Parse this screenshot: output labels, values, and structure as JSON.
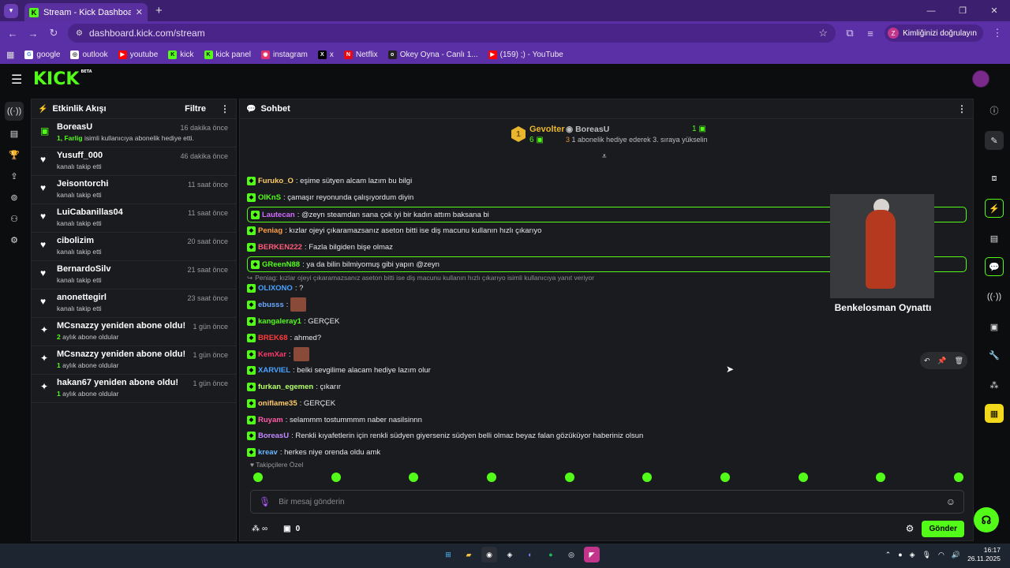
{
  "browser": {
    "tab_title": "Stream - Kick Dashboard",
    "url": "dashboard.kick.com/stream",
    "profile_label": "Kimliğinizi doğrulayın",
    "profile_initial": "Z",
    "bookmarks": [
      {
        "label": "google",
        "icon": "google-icon",
        "color": "#ffffff"
      },
      {
        "label": "outlook",
        "icon": "outlook-icon",
        "color": "#ffffff"
      },
      {
        "label": "youtube",
        "icon": "youtube-icon",
        "color": "#ff0000"
      },
      {
        "label": "kick",
        "icon": "kick-icon",
        "color": "#53fc18"
      },
      {
        "label": "kick panel",
        "icon": "kick-icon",
        "color": "#53fc18"
      },
      {
        "label": "instagram",
        "icon": "instagram-icon",
        "color": "#e1306c"
      },
      {
        "label": "x",
        "icon": "x-icon",
        "color": "#000000"
      },
      {
        "label": "Netflix",
        "icon": "netflix-icon",
        "color": "#e50914"
      },
      {
        "label": "Okey Oyna - Canlı 1...",
        "icon": "okey-icon",
        "color": "#222222"
      },
      {
        "label": "(159) ;) - YouTube",
        "icon": "youtube-icon",
        "color": "#ff0000"
      }
    ]
  },
  "kick": {
    "logo": "KICK",
    "logo_tag": "BETA",
    "accent": "#53fc18"
  },
  "activity": {
    "title": "Etkinlik Akışı",
    "filter_label": "Filtre",
    "items": [
      {
        "name": "BoreasU",
        "time": "16 dakika önce",
        "highlight": "1, Farlig",
        "sub": " isimli kullanıcıya abonelik hediye etti.",
        "icon": "gift-icon"
      },
      {
        "name": "Yusuff_000",
        "time": "46 dakika önce",
        "highlight": "",
        "sub": "kanalı takip etti",
        "icon": "heart-icon"
      },
      {
        "name": "Jeisontorchi",
        "time": "11 saat önce",
        "highlight": "",
        "sub": "kanalı takip etti",
        "icon": "heart-icon"
      },
      {
        "name": "LuiCabanillas04",
        "time": "11 saat önce",
        "highlight": "",
        "sub": "kanalı takip etti",
        "icon": "heart-icon"
      },
      {
        "name": "cibolizim",
        "time": "20 saat önce",
        "highlight": "",
        "sub": "kanalı takip etti",
        "icon": "heart-icon"
      },
      {
        "name": "BernardoSilv",
        "time": "21 saat önce",
        "highlight": "",
        "sub": "kanalı takip etti",
        "icon": "heart-icon"
      },
      {
        "name": "anonettegirl",
        "time": "23 saat önce",
        "highlight": "",
        "sub": "kanalı takip etti",
        "icon": "heart-icon"
      },
      {
        "name": "MCsnazzy yeniden abone oldu!",
        "time": "1 gün önce",
        "highlight": "2",
        "sub": " aylık abone oldular",
        "icon": "sparkle-icon"
      },
      {
        "name": "MCsnazzy yeniden abone oldu!",
        "time": "1 gün önce",
        "highlight": "1",
        "sub": " aylık abone oldular",
        "icon": "sparkle-icon"
      },
      {
        "name": "hakan67 yeniden abone oldu!",
        "time": "1 gün önce",
        "highlight": "1",
        "sub": " aylık abone oldular",
        "icon": "sparkle-icon"
      }
    ]
  },
  "chat": {
    "title": "Sohbet",
    "leaderboard": {
      "rank": "1",
      "top_user": "Gevolter",
      "top_count": "6",
      "second_user": "BoreasU",
      "second_count": "1",
      "second_rank": "3",
      "message": "1 abonelik hediye ederek 3. sıraya yükselin"
    },
    "messages": [
      {
        "user": "Furuko_O",
        "color": "#ffcc66",
        "text": ": eşime sütyen alcam lazım bu bilgi",
        "highlight": false,
        "emote": false
      },
      {
        "user": "OlKnS",
        "color": "#53fc18",
        "text": ": çamaşır reyonunda çalışıyordum diyin",
        "highlight": false,
        "emote": false
      },
      {
        "user": "Lautecan",
        "color": "#d26bff",
        "text": ": @zeyn steamdan sana çok iyi bir kadın attım baksana bi",
        "highlight": true,
        "emote": false
      },
      {
        "user": "Peniag",
        "color": "#ff9f43",
        "text": ": kızlar ojeyi çıkaramazsanız aseton bitti ise diş macunu kullanın hızlı çıkarıyo",
        "highlight": false,
        "emote": false
      },
      {
        "user": "BERKEN222",
        "color": "#ff5c7a",
        "text": ": Fazla bilgiden bişe olmaz",
        "highlight": false,
        "emote": false
      },
      {
        "user": "GReenN88",
        "color": "#53fc18",
        "text": ": ya da bilin bilmiyomuş gibi yapın @zeyn",
        "highlight": true,
        "emote": false
      },
      {
        "user": "OLIXONO",
        "color": "#4aa3ff",
        "text": ": ?",
        "highlight": false,
        "emote": false
      },
      {
        "user": "ebusss",
        "color": "#6aa8ff",
        "text": ":",
        "highlight": false,
        "emote": true
      },
      {
        "user": "kangaleray1",
        "color": "#53fc18",
        "text": ": GERÇEK",
        "highlight": false,
        "emote": false
      },
      {
        "user": "BREK68",
        "color": "#ff3b3b",
        "text": ": ahmed?",
        "highlight": false,
        "emote": false
      },
      {
        "user": "KemXar",
        "color": "#ff3b6b",
        "text": ":",
        "highlight": false,
        "emote": true
      },
      {
        "user": "XARVIEL",
        "color": "#4aa3ff",
        "text": ": belki sevgilime alacam hediye lazım olur",
        "highlight": false,
        "emote": false
      },
      {
        "user": "furkan_egemen",
        "color": "#b6ff6a",
        "text": ": çıkarır",
        "highlight": false,
        "emote": false
      },
      {
        "user": "oniflame35",
        "color": "#ffcc66",
        "text": ": GERÇEK",
        "highlight": false,
        "emote": false
      },
      {
        "user": "Ruyam",
        "color": "#ff5ca8",
        "text": ": selammm tostummmm naber nasilsinnn",
        "highlight": false,
        "emote": false
      },
      {
        "user": "BoreasU",
        "color": "#c28bff",
        "text": ": Renkli kıyafetlerin için renkli südyen giyerseniz südyen belli olmaz beyaz falan gözüküyor haberiniz olsun",
        "highlight": false,
        "emote": false
      },
      {
        "user": "kreav",
        "color": "#6ab8ff",
        "text": ": herkes niye orenda oldu amk",
        "highlight": false,
        "emote": false
      }
    ],
    "reply_note": "Peniag: kızlar ojeyi çıkaramazsanız aseton bitti ise diş macunu kullanın hızlı çıkarıyo isimli kullanıcıya yanıt veriyor",
    "overlay_caption": "Benkelosman Oynattı",
    "followers_only": "Takipçilere Özel",
    "input_placeholder": "Bir mesaj gönderin",
    "points": "∞",
    "store_count": "0",
    "send_label": "Gönder"
  },
  "taskbar": {
    "time": "16:17",
    "date": "26.11.2025"
  }
}
